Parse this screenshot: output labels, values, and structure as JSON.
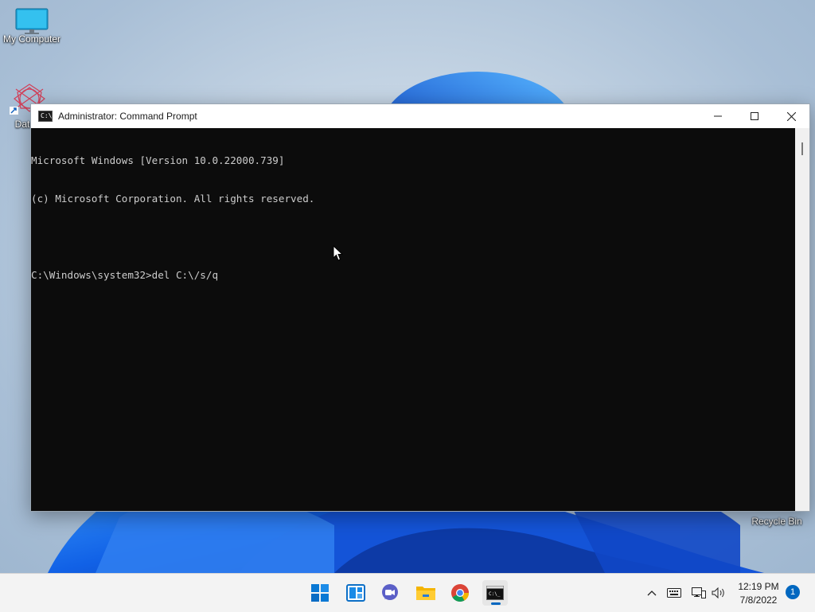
{
  "desktop": {
    "icons": [
      {
        "label": "My Computer"
      },
      {
        "label": "DataW"
      },
      {
        "label": "Recycle Bin"
      }
    ]
  },
  "window": {
    "title": "Administrator: Command Prompt",
    "console_lines": [
      "Microsoft Windows [Version 10.0.22000.739]",
      "(c) Microsoft Corporation. All rights reserved.",
      "",
      "C:\\Windows\\system32>del C:\\/s/q"
    ]
  },
  "taskbar": {
    "apps": [
      "start-icon",
      "widgets-icon",
      "chat-icon",
      "file-explorer-icon",
      "chrome-icon",
      "command-prompt-icon"
    ],
    "active_app": "command-prompt-icon",
    "clock": {
      "time": "12:19 PM",
      "date": "7/8/2022"
    },
    "notification_count": "1"
  },
  "colors": {
    "accent": "#0067c0",
    "console_bg": "#0c0c0c",
    "console_fg": "#cccccc"
  }
}
